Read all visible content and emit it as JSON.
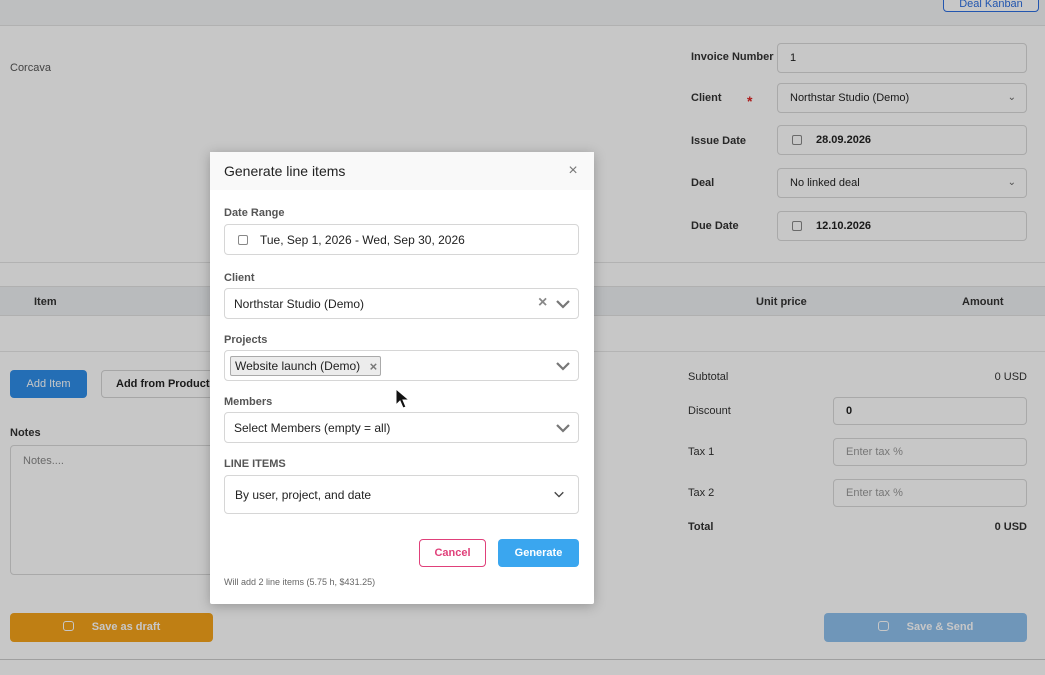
{
  "top": {
    "button_label": "Deal Kanban"
  },
  "company": {
    "name": "Corcava"
  },
  "invoice": {
    "number_label": "Invoice Number",
    "number_value": "1",
    "client_label": "Client",
    "client_value": "Northstar Studio (Demo)",
    "required_mark": "*",
    "issue_label": "Issue Date",
    "issue_value": "28.09.2026",
    "deal_label": "Deal",
    "deal_value": "No linked deal",
    "due_label": "Due Date",
    "due_value": "12.10.2026"
  },
  "table": {
    "col_item": "Item",
    "col_unit_price": "Unit price",
    "col_amount": "Amount"
  },
  "actions": {
    "add_item": "Add Item",
    "add_from_products": "Add from Products"
  },
  "notes": {
    "label": "Notes",
    "placeholder": "Notes...."
  },
  "summary": {
    "subtotal_label": "Subtotal",
    "subtotal_value": "0 USD",
    "discount_label": "Discount",
    "discount_value": "0",
    "tax1_label": "Tax 1",
    "tax1_placeholder": "Enter tax %",
    "tax2_label": "Tax 2",
    "tax2_placeholder": "Enter tax %",
    "total_label": "Total",
    "total_value": "0 USD"
  },
  "footer": {
    "save_draft": "Save as draft",
    "save_send": "Save & Send"
  },
  "modal": {
    "title": "Generate line items",
    "date_range_label": "Date Range",
    "date_range_value": "Tue, Sep 1, 2026 - Wed, Sep 30, 2026",
    "client_label": "Client",
    "client_value": "Northstar Studio (Demo)",
    "projects_label": "Projects",
    "project_tag": "Website launch (Demo)",
    "members_label": "Members",
    "members_placeholder": "Select Members (empty = all)",
    "line_items_label": "LINE ITEMS",
    "line_items_value": "By user, project, and date",
    "cancel": "Cancel",
    "generate": "Generate",
    "summary_note": "Will add 2 line items (5.75 h, $431.25)"
  }
}
